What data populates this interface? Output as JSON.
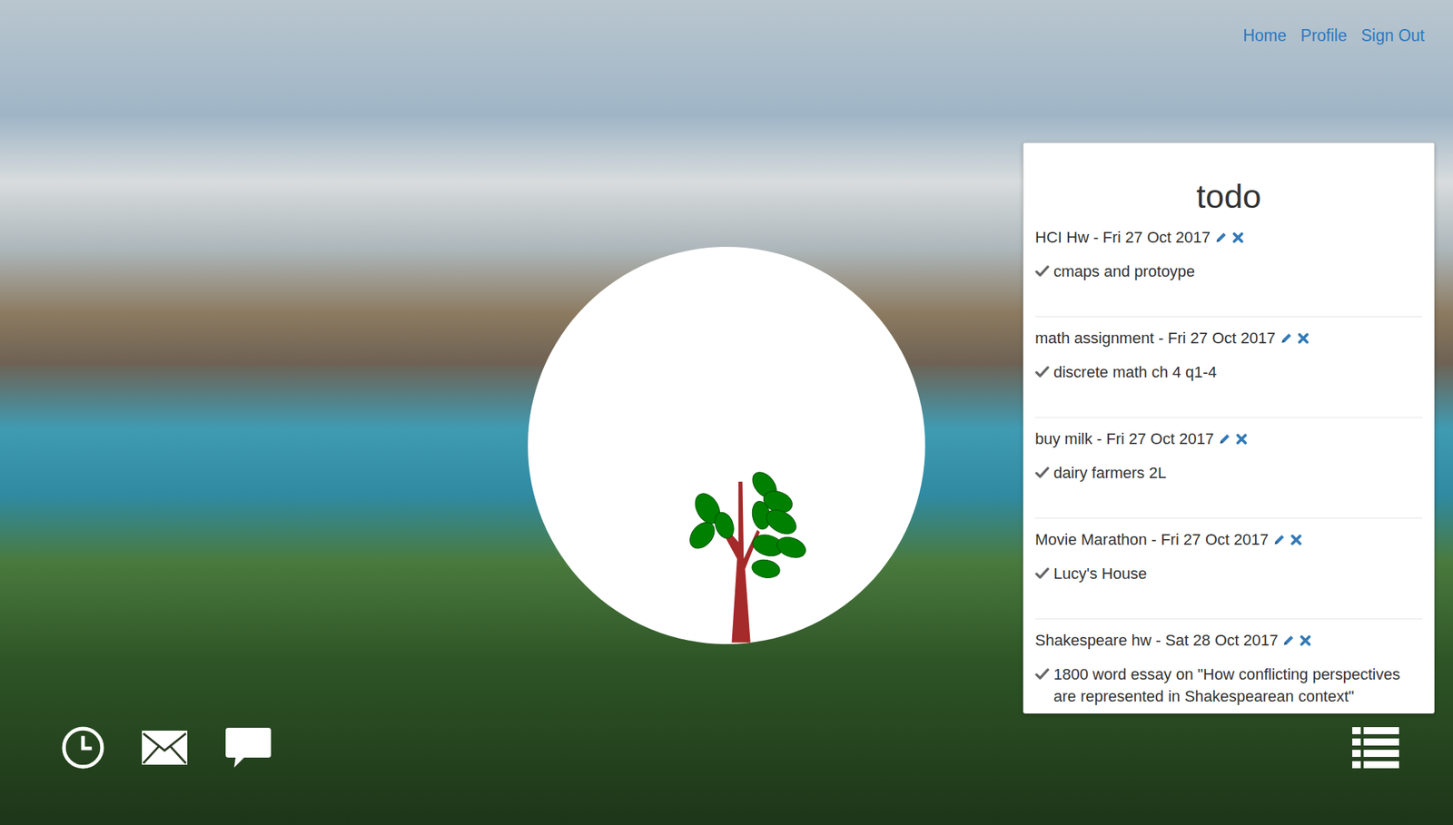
{
  "nav": [
    {
      "label": "Home"
    },
    {
      "label": "Profile"
    },
    {
      "label": "Sign Out"
    }
  ],
  "todo": {
    "title": "todo",
    "items": [
      {
        "heading": "HCI Hw - Fri 27 Oct 2017",
        "note": "cmaps and protoype"
      },
      {
        "heading": "math assignment - Fri 27 Oct 2017",
        "note": "discrete math ch 4 q1-4"
      },
      {
        "heading": "buy milk - Fri 27 Oct 2017",
        "note": "dairy farmers 2L"
      },
      {
        "heading": "Movie Marathon - Fri 27 Oct 2017",
        "note": "Lucy's House"
      },
      {
        "heading": "Shakespeare hw - Sat 28 Oct 2017",
        "note": "1800 word essay on \"How conflicting perspectives are represented in Shakespearean context\""
      }
    ]
  }
}
